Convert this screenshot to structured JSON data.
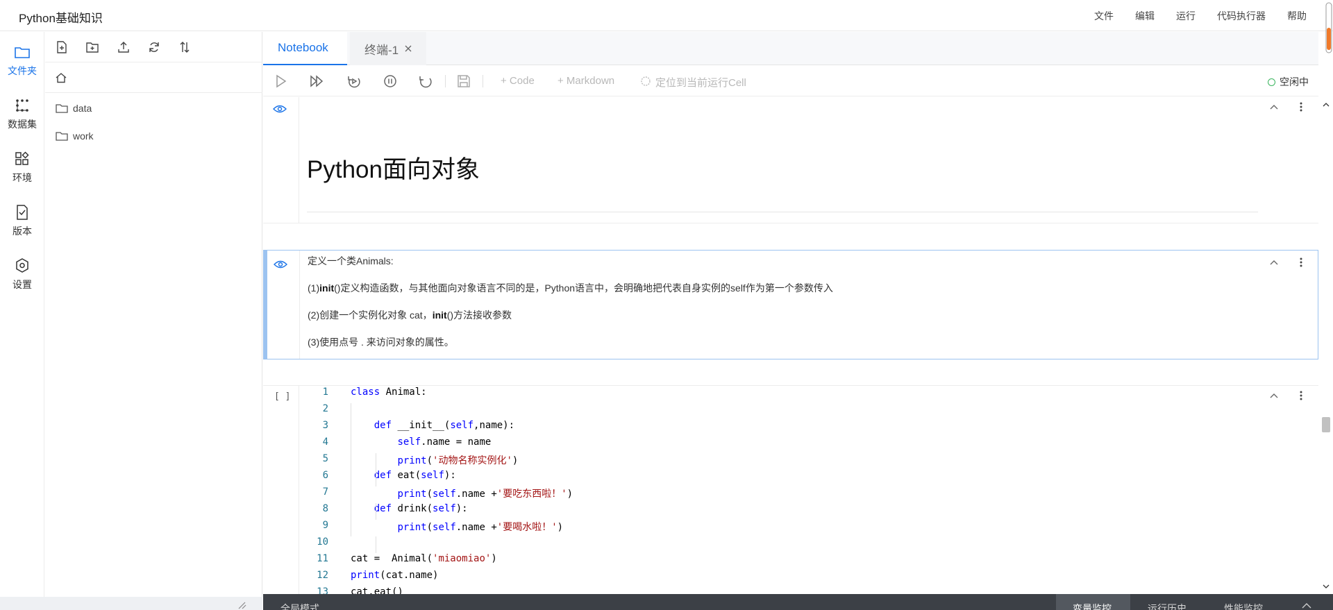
{
  "app": {
    "title": "Python基础知识"
  },
  "menu": [
    "文件",
    "编辑",
    "运行",
    "代码执行器",
    "帮助"
  ],
  "sidebar": {
    "items": [
      {
        "label": "文件夹",
        "icon": "folder-icon",
        "active": true
      },
      {
        "label": "数据集",
        "icon": "dataset-icon",
        "active": false
      },
      {
        "label": "环境",
        "icon": "environment-icon",
        "active": false
      },
      {
        "label": "版本",
        "icon": "version-icon",
        "active": false
      },
      {
        "label": "设置",
        "icon": "settings-icon",
        "active": false
      }
    ]
  },
  "files": {
    "toolbar": [
      "new-file-icon",
      "new-folder-icon",
      "upload-icon",
      "refresh-icon",
      "sort-icon"
    ],
    "path_icon": "home-icon",
    "items": [
      {
        "name": "data"
      },
      {
        "name": "work"
      }
    ]
  },
  "tabs": [
    {
      "label": "Notebook",
      "active": true
    },
    {
      "label": "终端-1",
      "active": false,
      "closable": true
    }
  ],
  "notebook_toolbar": {
    "add_code": "+ Code",
    "add_markdown": "+ Markdown",
    "locate": "定位到当前运行Cell",
    "status": "空闲中",
    "status_color": "#3bb55e"
  },
  "cells": {
    "md1": {
      "heading": "Python面向对象"
    },
    "md2": {
      "line1": "定义一个类Animals:",
      "line2_prefix": "(1)",
      "line2_bold": "init",
      "line2_rest": "()定义构造函数，与其他面向对象语言不同的是，Python语言中，会明确地把代表自身实例的self作为第一个参数传入",
      "line3_prefix": "(2)创建一个实例化对象 cat，",
      "line3_bold": "init",
      "line3_rest": "()方法接收参数",
      "line4": "(3)使用点号 . 来访问对象的属性。"
    },
    "code": {
      "exec_count": "[ ]",
      "lines": [
        "class Animal:",
        "",
        "    def __init__(self,name):",
        "        self.name = name",
        "        print('动物名称实例化')",
        "    def eat(self):",
        "        print(self.name +'要吃东西啦！')",
        "    def drink(self):",
        "        print(self.name +'要喝水啦！')",
        "",
        "cat =  Animal('miaomiao')",
        "print(cat.name)",
        "cat.eat()"
      ]
    }
  },
  "bottom": {
    "left": "全局模式",
    "tabs": [
      "变量监控",
      "运行历史",
      "性能监控"
    ],
    "active_tab": "变量监控"
  },
  "colors": {
    "accent": "#1a73e8",
    "selected_cell": "#9cc3f0"
  }
}
